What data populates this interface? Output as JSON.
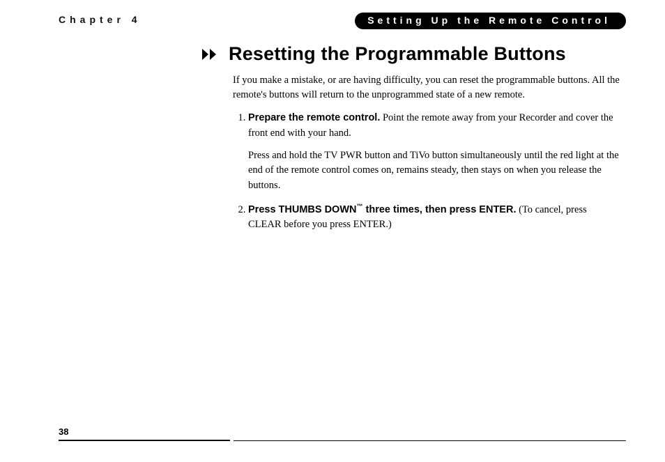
{
  "header": {
    "chapter_label": "Chapter 4",
    "section_header": "Setting Up the Remote Control"
  },
  "title": "Resetting the Programmable Buttons",
  "intro": "If you make a mistake, or are having difficulty, you can reset the programmable buttons. All the remote's buttons will return to the unprogrammed state of a new remote.",
  "steps": [
    {
      "lead": "Prepare the remote control.",
      "text": " Point the remote away from your Recorder and cover the front end with your hand.",
      "para2": "Press and hold the TV PWR button and TiVo button simultaneously until the red light at the end of the remote control comes on, remains steady, then stays on when you release the buttons."
    },
    {
      "lead_pre": "Press THUMBS DOWN",
      "lead_tm": "™",
      "lead_post": " three times, then press ENTER.",
      "text": " (To cancel, press CLEAR before you press ENTER.)"
    }
  ],
  "page_number": "38"
}
